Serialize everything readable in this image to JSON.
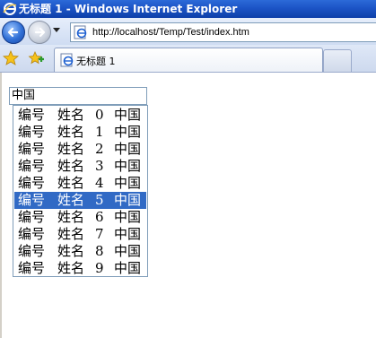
{
  "window": {
    "title": "无标题 1 - Windows Internet Explorer"
  },
  "navigation": {
    "address": "http://localhost/Temp/Test/index.htm"
  },
  "tabs": [
    {
      "label": "无标题 1"
    }
  ],
  "search": {
    "value": "中国"
  },
  "suggestions": {
    "selected_index": 5,
    "selected_color": "#316ac5",
    "items": [
      {
        "code": "编号",
        "name": "姓名",
        "num": "0",
        "text": "中国"
      },
      {
        "code": "编号",
        "name": "姓名",
        "num": "1",
        "text": "中国"
      },
      {
        "code": "编号",
        "name": "姓名",
        "num": "2",
        "text": "中国"
      },
      {
        "code": "编号",
        "name": "姓名",
        "num": "3",
        "text": "中国"
      },
      {
        "code": "编号",
        "name": "姓名",
        "num": "4",
        "text": "中国"
      },
      {
        "code": "编号",
        "name": "姓名",
        "num": "5",
        "text": "中国"
      },
      {
        "code": "编号",
        "name": "姓名",
        "num": "6",
        "text": "中国"
      },
      {
        "code": "编号",
        "name": "姓名",
        "num": "7",
        "text": "中国"
      },
      {
        "code": "编号",
        "name": "姓名",
        "num": "8",
        "text": "中国"
      },
      {
        "code": "编号",
        "name": "姓名",
        "num": "9",
        "text": "中国"
      }
    ]
  }
}
